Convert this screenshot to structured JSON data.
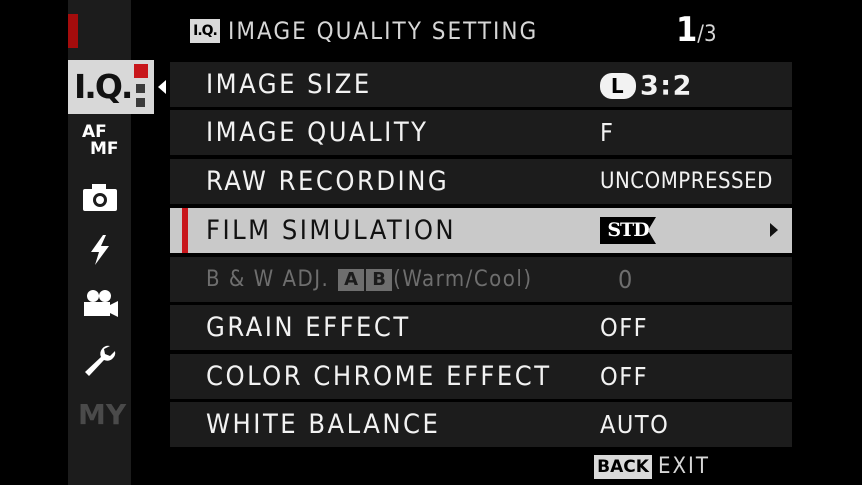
{
  "header": {
    "badge": "I.Q.",
    "title": "IMAGE QUALITY SETTING",
    "page_current": "1",
    "page_total": "/3"
  },
  "sidebar": {
    "items": [
      {
        "name": "image-quality",
        "label": "I.Q.",
        "selected": true
      },
      {
        "name": "af-mf",
        "label_top": "AF",
        "label_bottom": "MF"
      },
      {
        "name": "camera",
        "icon": "camera-icon"
      },
      {
        "name": "flash",
        "icon": "flash-icon"
      },
      {
        "name": "movie",
        "icon": "movie-camera-icon"
      },
      {
        "name": "setup",
        "icon": "wrench-icon"
      },
      {
        "name": "my-menu",
        "label": "MY"
      }
    ]
  },
  "menu": {
    "rows": [
      {
        "label": "IMAGE SIZE",
        "size_badge": "L",
        "ratio": "3:2"
      },
      {
        "label": "IMAGE QUALITY",
        "value": "F"
      },
      {
        "label": "RAW RECORDING",
        "value": "UNCOMPRESSED"
      },
      {
        "label": "FILM SIMULATION",
        "value_badge": "STD",
        "selected": true
      },
      {
        "label_prefix": "B & W ADJ.",
        "icon_a": "A",
        "icon_b": "B",
        "label_suffix": "(Warm/Cool)",
        "value": "0",
        "disabled": true
      },
      {
        "label": "GRAIN EFFECT",
        "value": "OFF"
      },
      {
        "label": "COLOR CHROME EFFECT",
        "value": "OFF"
      },
      {
        "label": "WHITE BALANCE",
        "value": "AUTO"
      }
    ]
  },
  "footer": {
    "back_badge": "BACK",
    "exit_label": "EXIT"
  },
  "colors": {
    "accent_red": "#c8161b",
    "row_bg": "#1c1c1c",
    "selected_bg": "#c9c9c9",
    "disabled_text": "#6e6e6e"
  }
}
